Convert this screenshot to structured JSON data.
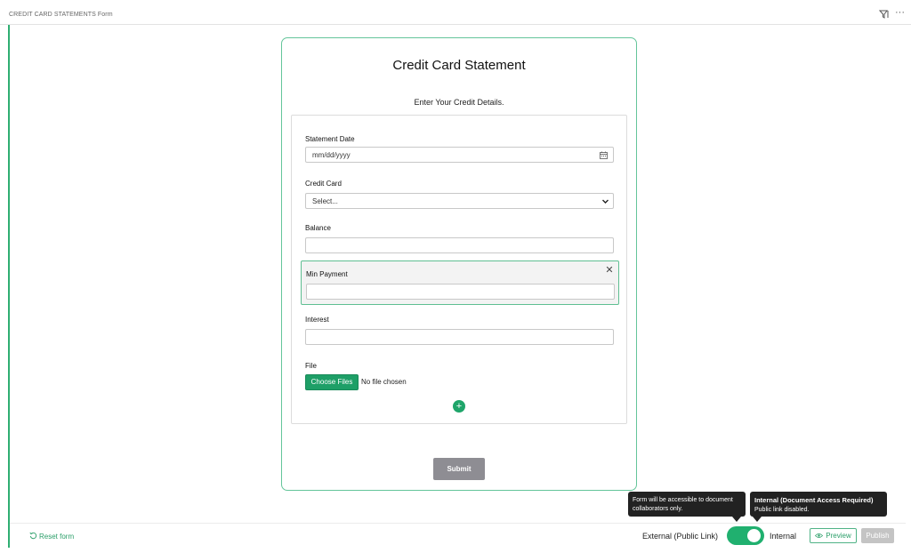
{
  "header": {
    "title": "CREDIT CARD STATEMENTS Form",
    "filter_icon": "filter-icon",
    "more_icon": "more-icon",
    "more_glyph": "···"
  },
  "form": {
    "title": "Credit Card Statement",
    "subtitle": "Enter Your Credit Details.",
    "fields": {
      "statement_date": {
        "label": "Statement Date",
        "placeholder": "mm/dd/yyyy"
      },
      "credit_card": {
        "label": "Credit Card",
        "value": "Select..."
      },
      "balance": {
        "label": "Balance",
        "value": ""
      },
      "min_payment": {
        "label": "Min Payment",
        "value": ""
      },
      "interest": {
        "label": "Interest",
        "value": ""
      },
      "file": {
        "label": "File",
        "button_label": "Choose Files",
        "status": "No file chosen"
      }
    },
    "close_glyph": "✕",
    "add_glyph": "+",
    "submit_label": "Submit"
  },
  "footer": {
    "reset_label": "Reset form",
    "external_label": "External (Public Link)",
    "internal_label": "Internal",
    "toggle_state": "internal",
    "preview_label": "Preview",
    "publish_label": "Publish"
  },
  "tooltips": {
    "toggle_tip": "Form will be accessible to document collaborators only.",
    "internal_tip_title": "Internal (Document Access Required)",
    "internal_tip_body": "Public link disabled."
  },
  "colors": {
    "accent": "#1fa56a",
    "submit": "#8e8d93",
    "publish_disabled": "#c4c4c4"
  }
}
